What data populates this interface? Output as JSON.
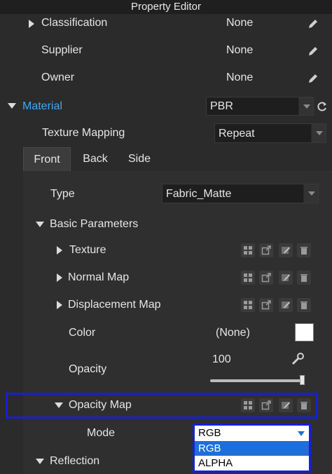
{
  "window": {
    "title": "Property Editor"
  },
  "properties": {
    "classification": {
      "label": "Classification",
      "value": "None"
    },
    "supplier": {
      "label": "Supplier",
      "value": "None"
    },
    "owner": {
      "label": "Owner",
      "value": "None"
    }
  },
  "material": {
    "label": "Material",
    "type_value": "PBR",
    "texture_mapping_label": "Texture Mapping",
    "texture_mapping_value": "Repeat"
  },
  "tabs": [
    "Front",
    "Back",
    "Side"
  ],
  "front": {
    "type_label": "Type",
    "type_value": "Fabric_Matte",
    "basic_parameters_label": "Basic Parameters",
    "texture_label": "Texture",
    "normal_map_label": "Normal Map",
    "displacement_map_label": "Displacement Map",
    "color_label": "Color",
    "color_value": "(None)",
    "color_swatch": "#ffffff",
    "opacity_label": "Opacity",
    "opacity_value": "100",
    "opacity_level": 1.0,
    "opacity_map_label": "Opacity Map",
    "mode_label": "Mode",
    "mode_value": "RGB",
    "mode_options": [
      "RGB",
      "ALPHA"
    ],
    "mode_selected": "RGB",
    "reflection_label": "Reflection"
  },
  "colors": {
    "accent": "#1520d8",
    "material_label": "#3fa9f5",
    "selection": "#1e6fd9"
  }
}
